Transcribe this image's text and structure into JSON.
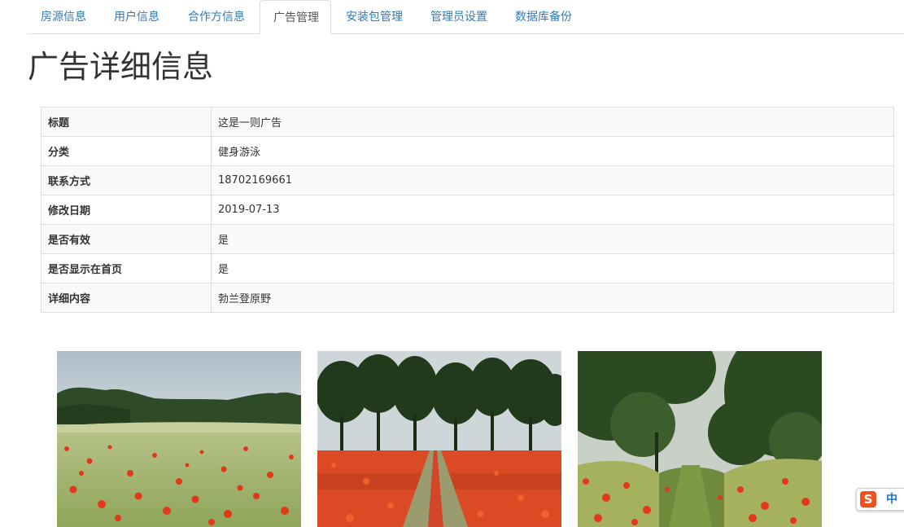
{
  "nav": {
    "tabs": [
      {
        "label": "房源信息",
        "active": false
      },
      {
        "label": "用户信息",
        "active": false
      },
      {
        "label": "合作方信息",
        "active": false
      },
      {
        "label": "广告管理",
        "active": true
      },
      {
        "label": "安装包管理",
        "active": false
      },
      {
        "label": "管理员设置",
        "active": false
      },
      {
        "label": "数据库备份",
        "active": false
      }
    ]
  },
  "page": {
    "title": "广告详细信息"
  },
  "details": {
    "rows": [
      {
        "key": "标题",
        "value": "这是一则广告"
      },
      {
        "key": "分类",
        "value": "健身游泳"
      },
      {
        "key": "联系方式",
        "value": "18702169661"
      },
      {
        "key": "修改日期",
        "value": "2019-07-13"
      },
      {
        "key": "是否有效",
        "value": "是"
      },
      {
        "key": "是否显示在首页",
        "value": "是"
      },
      {
        "key": "详细内容",
        "value": "勃兰登原野"
      }
    ]
  },
  "gallery": {
    "images": [
      {
        "subject": "poppy-field-treeline"
      },
      {
        "subject": "poppy-field-tree-avenue-path"
      },
      {
        "subject": "poppy-field-path-between-trees"
      }
    ]
  },
  "ime": {
    "logo": "S",
    "mode": "中"
  },
  "colors": {
    "link": "#337ab7",
    "border": "#dddddd",
    "stripe": "#f9f9f9",
    "ime_brand": "#f0521f"
  }
}
